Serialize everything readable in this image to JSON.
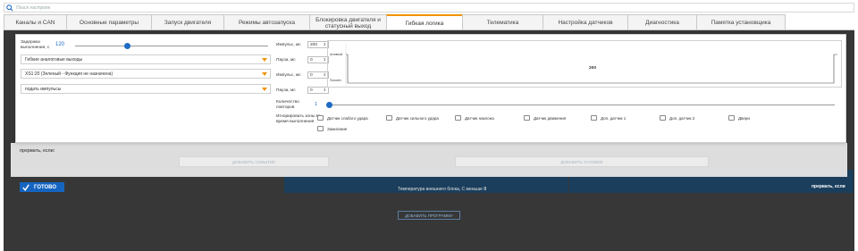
{
  "search": {
    "placeholder": "Поиск настроек"
  },
  "tabs": [
    {
      "label": "Каналы и CAN",
      "active": false
    },
    {
      "label": "Основные параметры",
      "active": false
    },
    {
      "label": "Запуск двигателя",
      "active": false
    },
    {
      "label": "Режимы автозапуска",
      "active": false
    },
    {
      "label": "Блокировка двигателя и статусный выход",
      "active": false
    },
    {
      "label": "Гибкая логика",
      "active": true
    },
    {
      "label": "Телематика",
      "active": false
    },
    {
      "label": "Настройка датчиков",
      "active": false
    },
    {
      "label": "Диагностика",
      "active": false
    },
    {
      "label": "Памятка установщика",
      "active": false
    }
  ],
  "modal": {
    "delay_label": "Задержка выполнения, с",
    "delay_value": "120",
    "delay_fraction": 0.27,
    "dropdowns": [
      "Гибкие аналоговые выходы",
      "XS1:20 (Зеленый - Функция не назначена)",
      "подать импульсы"
    ],
    "pulse1_label": "Импульс, мс",
    "pulse1_value": "200",
    "pause1_label": "Пауза, мс",
    "pause1_value": "0",
    "pulse2_label": "Импульс, мс",
    "pulse2_value": "0",
    "pause2_label": "Пауза, мс",
    "pause2_value": "0",
    "graph": {
      "active_label": "Активный",
      "idle_label": "Пассивн",
      "peak_label": "200"
    },
    "repeats_label": "Количество повторов",
    "repeats_value": "1",
    "repeats_fraction": 0.0,
    "ignore_label": "Игнорировать зоны во время выполнения",
    "checkboxes": [
      "Датчик слабого удара",
      "Датчик сильного удара",
      "Датчик наклона",
      "Датчик движения",
      "Доп. датчик 1",
      "Доп. датчик 2",
      "Двери",
      "Зажигание"
    ]
  },
  "band": {
    "label": "прервать, если:",
    "add_event": "ДОБАВИТЬ СОБЫТИЕ",
    "add_condition": "ДОБАВИТЬ УСЛОВИЕ"
  },
  "done_label": "ГОТОВО",
  "background": {
    "condition_text": "Температура внешнего блока, С меньше",
    "condition_value": "0",
    "add_program": "ДОБАВИТЬ ПРОГРАММУ",
    "interrupt_right": "прервать, если"
  },
  "colors": {
    "accent": "#f39200",
    "primary": "#1e6bc5",
    "done": "#1565c0",
    "dark": "#373737"
  }
}
